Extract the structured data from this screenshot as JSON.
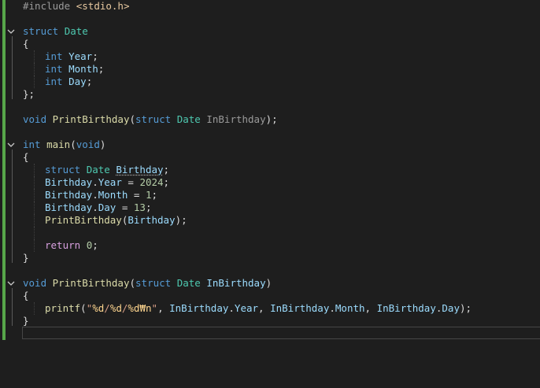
{
  "editor": {
    "language": "C",
    "theme": "dark",
    "colors": {
      "background": "#1e1e1e",
      "change_bar": "#57a64a",
      "keyword": "#569cd6",
      "type": "#4ec9b0",
      "function": "#dcdcaa",
      "variable": "#9cdcfe",
      "string": "#d69d85",
      "number": "#b5cea8",
      "control": "#d8a0df"
    },
    "code": {
      "l1_directive": "#include",
      "l1_header": "<stdio.h>",
      "l3_struct": "struct",
      "l3_name": "Date",
      "open_brace": "{",
      "close_brace": "}",
      "close_brace_semi": "};",
      "int": "int",
      "field_year": "Year",
      "field_month": "Month",
      "field_day": "Day",
      "semi": ";",
      "void": "void",
      "fn_print": "PrintBirthday",
      "lparen": "(",
      "rparen": ")",
      "rparen_semi": ");",
      "struct_kw": "struct",
      "date_type": "Date",
      "param_name": "InBirthday",
      "main": "main",
      "void_param": "void",
      "var_birthday": "Birthday",
      "dot": ".",
      "assign": " = ",
      "year_val": "2024",
      "month_val": "1",
      "day_val": "13",
      "return_kw": "return",
      "zero": "0",
      "printf": "printf",
      "quote": "\"",
      "fmt_d1": "%d",
      "slash": "/",
      "fmt_d2": "%d",
      "fmt_d3": "%d",
      "fmt_newline": "₩n",
      "comma_space": ", ",
      "param_year": "InBirthday",
      "param_month": "InBirthday",
      "param_day": "InBirthday"
    }
  }
}
